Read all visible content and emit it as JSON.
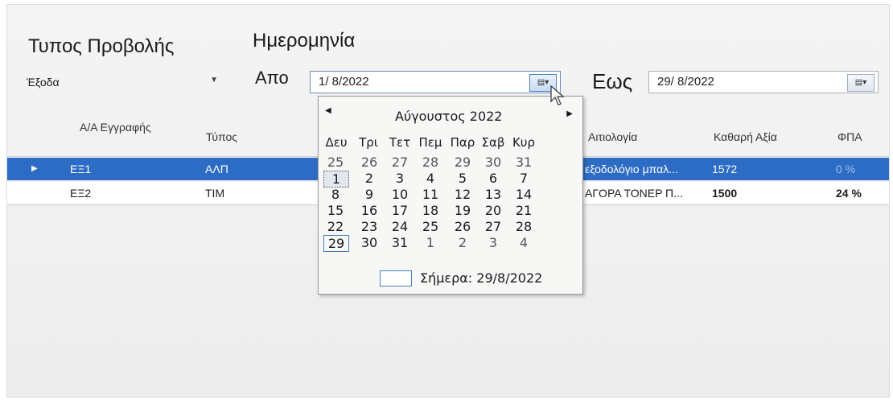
{
  "filters": {
    "type_label": "Τυπος Προβολής",
    "type_value": "Έξοδα",
    "date_label": "Ημερομηνία",
    "from_label": "Απο",
    "from_value": "1/ 8/2022",
    "to_label": "Εως",
    "to_value": "29/ 8/2022"
  },
  "grid": {
    "columns": [
      "Α/Α Εγγραφής",
      "Τύπος",
      "Αιτιολογία",
      "Καθαρή Αξία",
      "ΦΠΑ"
    ],
    "rows": [
      {
        "aa": "ΕΞ1",
        "type": "ΑΛΠ",
        "reason": "εξοδολόγιο μπαλ...",
        "net": "1572",
        "vat": "0 %",
        "selected": true
      },
      {
        "aa": "ΕΞ2",
        "type": "ΤΙΜ",
        "reason": "ΑΓΟΡΑ ΤΟΝΕΡ Π...",
        "net": "1500",
        "vat": "24 %",
        "selected": false
      }
    ]
  },
  "calendar": {
    "month_title": "Αύγουστος 2022",
    "weekdays": [
      "Δευ",
      "Τρι",
      "Τετ",
      "Πεμ",
      "Παρ",
      "Σαβ",
      "Κυρ"
    ],
    "weeks": [
      [
        "25",
        "26",
        "27",
        "28",
        "29",
        "30",
        "31"
      ],
      [
        "1",
        "2",
        "3",
        "4",
        "5",
        "6",
        "7"
      ],
      [
        "8",
        "9",
        "10",
        "11",
        "12",
        "13",
        "14"
      ],
      [
        "15",
        "16",
        "17",
        "18",
        "19",
        "20",
        "21"
      ],
      [
        "22",
        "23",
        "24",
        "25",
        "26",
        "27",
        "28"
      ],
      [
        "29",
        "30",
        "31",
        "1",
        "2",
        "3",
        "4"
      ]
    ],
    "selected_day": "1",
    "today_day": "29",
    "today_label": "Σήμερα: 29/8/2022"
  },
  "icons": {
    "dropdown": "chevron-down-icon",
    "calendar": "calendar-icon",
    "prev": "triangle-left-icon",
    "next": "triangle-right-icon",
    "row_marker": "triangle-right-icon"
  },
  "colors": {
    "selection": "#2d6cc4",
    "accent_border": "#4a7fc0"
  }
}
